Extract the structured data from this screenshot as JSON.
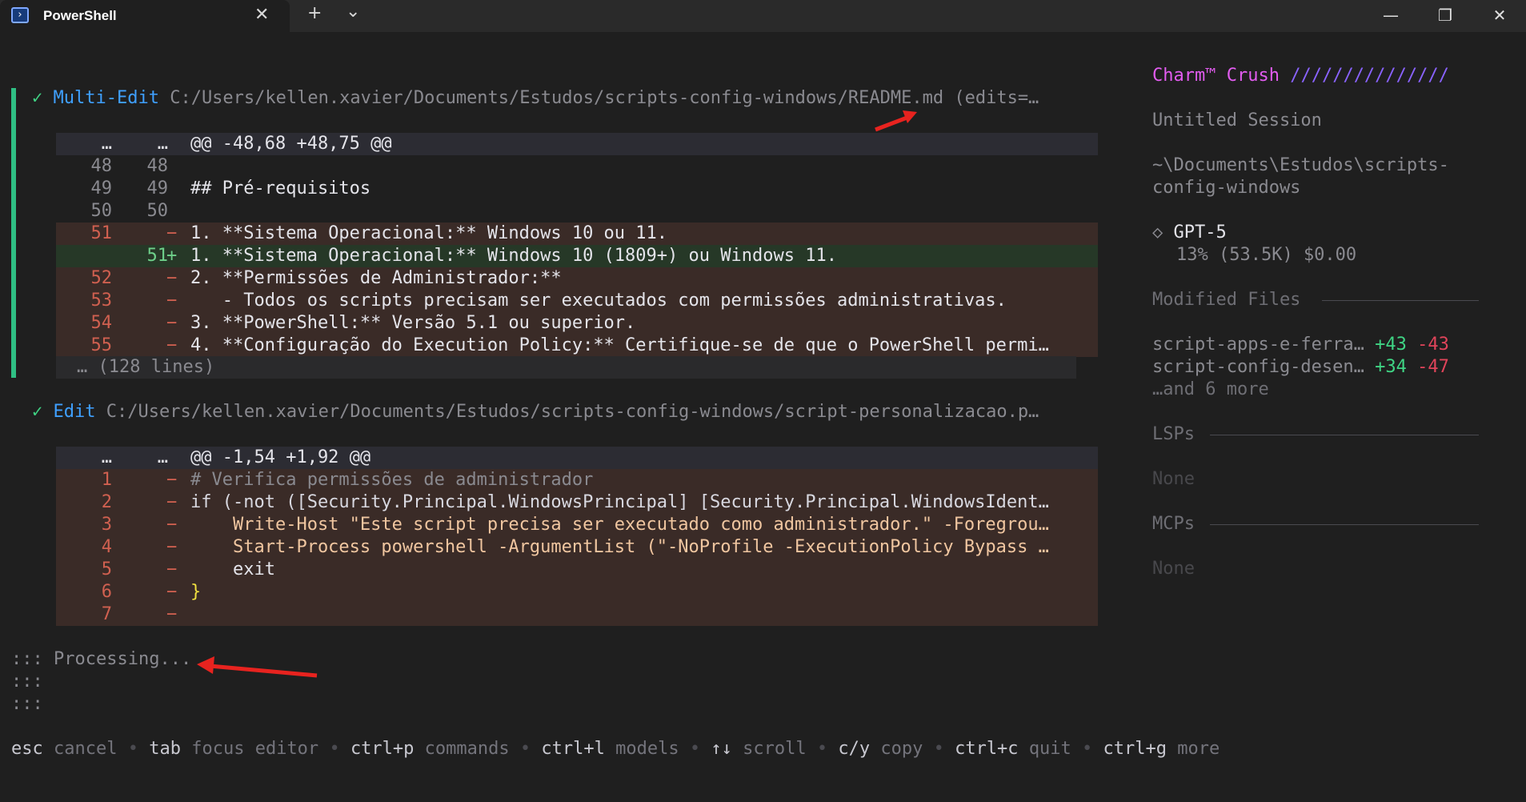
{
  "window": {
    "tab_title": "PowerShell",
    "tab_close": "✕",
    "new_tab": "+",
    "dropdown": "⌄",
    "minimize": "—",
    "restore": "❐",
    "close": "✕"
  },
  "blocks": [
    {
      "check": "✓",
      "tool": "Multi-Edit",
      "path": "C:/Users/kellen.xavier/Documents/Estudos/scripts-config-windows/README.md (edits=…",
      "hunk_old": "…",
      "hunk_new": "…",
      "hunk": "@@ -48,68 +48,75 @@",
      "lines": [
        {
          "type": "ctx",
          "old": "48",
          "new": "48",
          "sign": "",
          "text": ""
        },
        {
          "type": "ctx",
          "old": "49",
          "new": "49",
          "sign": "",
          "text": "## Pré-requisitos"
        },
        {
          "type": "ctx",
          "old": "50",
          "new": "50",
          "sign": "",
          "text": ""
        },
        {
          "type": "del",
          "old": "51",
          "new": "",
          "sign": "−",
          "text": "1. **Sistema Operacional:** Windows 10 ou 11."
        },
        {
          "type": "add",
          "old": "",
          "new": "51",
          "sign": "+",
          "text": "1. **Sistema Operacional:** Windows 10 (1809+) ou Windows 11."
        },
        {
          "type": "del",
          "old": "52",
          "new": "",
          "sign": "−",
          "text": "2. **Permissões de Administrador:**"
        },
        {
          "type": "del",
          "old": "53",
          "new": "",
          "sign": "−",
          "text": "   - Todos os scripts precisam ser executados com permissões administrativas."
        },
        {
          "type": "del",
          "old": "54",
          "new": "",
          "sign": "−",
          "text": "3. **PowerShell:** Versão 5.1 ou superior."
        },
        {
          "type": "del",
          "old": "55",
          "new": "",
          "sign": "−",
          "text": "4. **Configuração do Execution Policy:** Certifique-se de que o PowerShell permi…"
        }
      ],
      "more": "… (128 lines)"
    },
    {
      "check": "✓",
      "tool": "Edit",
      "path": "C:/Users/kellen.xavier/Documents/Estudos/scripts-config-windows/script-personalizacao.p…",
      "hunk_old": "…",
      "hunk_new": "…",
      "hunk": "@@ -1,54 +1,92 @@",
      "lines": [
        {
          "type": "del",
          "old": "1",
          "new": "",
          "sign": "−",
          "text": "# Verifica permissões de administrador"
        },
        {
          "type": "del",
          "old": "2",
          "new": "",
          "sign": "−",
          "text": "if (-not ([Security.Principal.WindowsPrincipal] [Security.Principal.WindowsIdent…"
        },
        {
          "type": "del",
          "old": "3",
          "new": "",
          "sign": "−",
          "text": "    Write-Host \"Este script precisa ser executado como administrador.\" -Foregrou…"
        },
        {
          "type": "del",
          "old": "4",
          "new": "",
          "sign": "−",
          "text": "    Start-Process powershell -ArgumentList (\"-NoProfile -ExecutionPolicy Bypass …"
        },
        {
          "type": "del",
          "old": "5",
          "new": "",
          "sign": "−",
          "text": "    exit"
        },
        {
          "type": "del",
          "old": "6",
          "new": "",
          "sign": "−",
          "text": "}"
        },
        {
          "type": "del",
          "old": "7",
          "new": "",
          "sign": "−",
          "text": ""
        }
      ]
    }
  ],
  "status": {
    "spinner": [
      ":::",
      ":::",
      ":::"
    ],
    "text": "Processing..."
  },
  "help": [
    {
      "key": "esc",
      "desc": "cancel"
    },
    {
      "key": "tab",
      "desc": "focus editor"
    },
    {
      "key": "ctrl+p",
      "desc": "commands"
    },
    {
      "key": "ctrl+l",
      "desc": "models"
    },
    {
      "key": "↑↓",
      "desc": "scroll"
    },
    {
      "key": "c/y",
      "desc": "copy"
    },
    {
      "key": "ctrl+c",
      "desc": "quit"
    },
    {
      "key": "ctrl+g",
      "desc": "more"
    }
  ],
  "help_sep": "•",
  "sidebar": {
    "brand": "Charm™",
    "product": "Crush",
    "slashes": "///////////////",
    "session": "Untitled Session",
    "cwd_line1": "~\\Documents\\Estudos\\scripts-",
    "cwd_line2": "config-windows",
    "model_icon": "◇",
    "model": "GPT-5",
    "usage": "13% (53.5K) $0.00",
    "modified_title": "Modified Files",
    "files": [
      {
        "name": "script-apps-e-ferra…",
        "add": "+43",
        "del": "-43"
      },
      {
        "name": "script-config-desen…",
        "add": "+34",
        "del": "-47"
      }
    ],
    "files_more": "…and 6 more",
    "lsps_title": "LSPs",
    "lsps_value": "None",
    "mcps_title": "MCPs",
    "mcps_value": "None"
  },
  "colors": {
    "accent_pink": "#e25cf0",
    "accent_purple": "#8a63ff",
    "green": "#3fd484",
    "red": "#e0445a",
    "blue": "#3fa0ff",
    "annotation_arrow": "#e8231f"
  }
}
